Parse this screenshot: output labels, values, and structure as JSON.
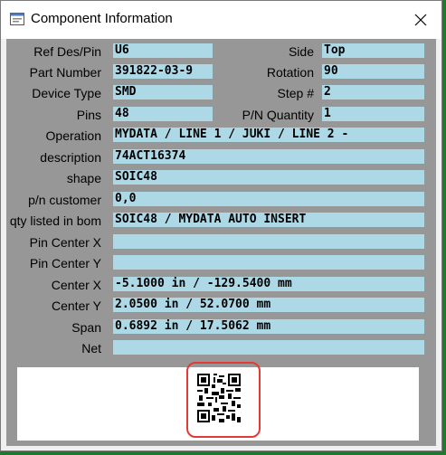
{
  "window": {
    "title": "Component Information"
  },
  "fields": [
    {
      "label": "Ref Des/Pin",
      "value": "U6"
    },
    {
      "label": "Part Number",
      "value": "391822-03-9"
    },
    {
      "label": "Device Type",
      "value": "SMD"
    },
    {
      "label": "Pins",
      "value": "48"
    },
    {
      "label": "Operation",
      "value": "MYDATA / LINE 1 / JUKI / LINE 2 -"
    },
    {
      "label": "description",
      "value": "74ACT16374"
    },
    {
      "label": "shape",
      "value": "SOIC48"
    },
    {
      "label": "p/n customer",
      "value": "0,0"
    },
    {
      "label": "qty listed in bom",
      "value": "SOIC48 / MYDATA AUTO INSERT"
    },
    {
      "label": "Pin Center X",
      "value": ""
    },
    {
      "label": "Pin Center Y",
      "value": ""
    },
    {
      "label": "Center X",
      "value": "-5.1000 in / -129.5400 mm"
    },
    {
      "label": "Center Y",
      "value": "2.0500 in / 52.0700 mm"
    },
    {
      "label": "Span",
      "value": "0.6892 in / 17.5062 mm"
    },
    {
      "label": "Net",
      "value": ""
    }
  ],
  "right_fields": [
    {
      "label": "Side",
      "value": "Top"
    },
    {
      "label": "Rotation",
      "value": "90"
    },
    {
      "label": "Step #",
      "value": "2"
    },
    {
      "label": "P/N Quantity",
      "value": "1"
    }
  ],
  "icons": {
    "app": "app-window-icon",
    "close": "close-icon",
    "qr": "qr-code-icon"
  },
  "colors": {
    "field_bg": "#add8e6",
    "client_bg": "#979797",
    "highlight": "#e53935"
  }
}
